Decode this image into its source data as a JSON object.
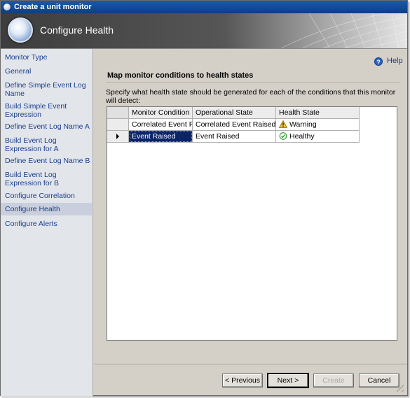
{
  "window": {
    "title": "Create a unit monitor",
    "header_title": "Configure Health"
  },
  "nav": {
    "items": [
      {
        "label": "Monitor Type"
      },
      {
        "label": "General"
      },
      {
        "label": "Define Simple Event Log Name"
      },
      {
        "label": "Build Simple Event Expression"
      },
      {
        "label": "Define Event Log Name A"
      },
      {
        "label": "Build Event Log Expression for A"
      },
      {
        "label": "Define Event Log Name B"
      },
      {
        "label": "Build Event Log Expression for B"
      },
      {
        "label": "Configure Correlation"
      },
      {
        "label": "Configure Health",
        "active": true
      },
      {
        "label": "Configure Alerts"
      }
    ]
  },
  "help": {
    "label": "Help",
    "icon": "help-icon"
  },
  "section": {
    "title": "Map monitor conditions to health states",
    "instruction": "Specify what health state should be generated for each of the conditions that this monitor will detect:"
  },
  "grid": {
    "columns": [
      "Monitor Condition",
      "Operational State",
      "Health State"
    ],
    "rows": [
      {
        "condition": "Correlated Event Ra...",
        "operational_state": "Correlated Event Raised",
        "health_state": "Warning",
        "health_icon": "warning-icon",
        "current": false
      },
      {
        "condition": "Event Raised",
        "operational_state": "Event Raised",
        "health_state": "Healthy",
        "health_icon": "healthy-check-icon",
        "current": true
      }
    ]
  },
  "buttons": {
    "previous": "< Previous",
    "next": "Next >",
    "create": "Create",
    "cancel": "Cancel"
  },
  "colors": {
    "title_bar": "#0b3f86",
    "nav_link": "#1a3f8f",
    "selection": "#0a246a",
    "warning": "#f2c230",
    "healthy": "#2e9a2e"
  }
}
